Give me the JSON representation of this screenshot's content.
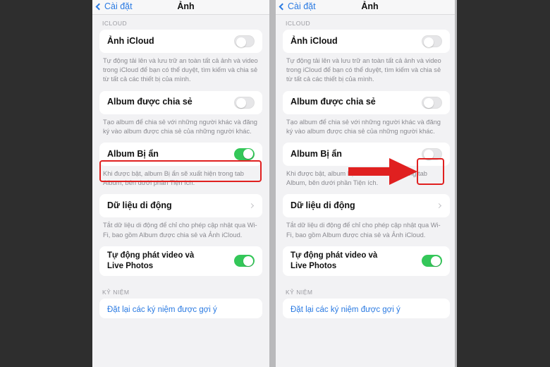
{
  "meta": {
    "backdrop_color": "#2e2e2e",
    "accent_blue": "#2a7ae2",
    "toggle_on_color": "#34c759",
    "annotation_red": "#e02020"
  },
  "navbar": {
    "back_label": "Cài đặt",
    "title": "Ảnh",
    "back_icon": "chevron-left-icon"
  },
  "sections": {
    "icloud_header": "ICLOUD",
    "memories_header": "KỶ NIỆM"
  },
  "rows": {
    "icloud_photos": {
      "label": "Ảnh iCloud",
      "toggle_state": "off",
      "footnote": "Tự động tải lên và lưu trữ an toàn tất cả ảnh và video trong iCloud để bạn có thể duyệt, tìm kiếm và chia sẻ từ tất cả các thiết bị của mình."
    },
    "shared_album": {
      "label": "Album được chia sẻ",
      "toggle_state": "off",
      "footnote": "Tạo album để chia sẻ với những người khác và đăng ký vào album được chia sẻ của những người khác."
    },
    "hidden_album": {
      "label": "Album Bị ẩn",
      "toggle_state_left": "on",
      "toggle_state_right": "off",
      "footnote": "Khi được bật, album Bị ẩn sẽ xuất hiện trong tab Album, bên dưới phần Tiện ích."
    },
    "cellular_data": {
      "label": "Dữ liệu di động",
      "disclosure_icon": "chevron-right-icon",
      "footnote": "Tắt dữ liệu di động để chỉ cho phép cập nhật qua Wi-Fi, bao gồm Album được chia sẻ và Ảnh iCloud."
    },
    "autoplay": {
      "label_line1": "Tự động phát video và",
      "label_line2": "Live Photos",
      "toggle_state": "on"
    },
    "reset_memories": {
      "label": "Đặt lại các ký niệm được gợi ý"
    }
  },
  "annotations": {
    "left_highlight_target": "hidden-album-row",
    "right_highlight_target": "hidden-album-toggle",
    "arrow_icon": "right-arrow-icon",
    "arrow_direction": "right"
  }
}
